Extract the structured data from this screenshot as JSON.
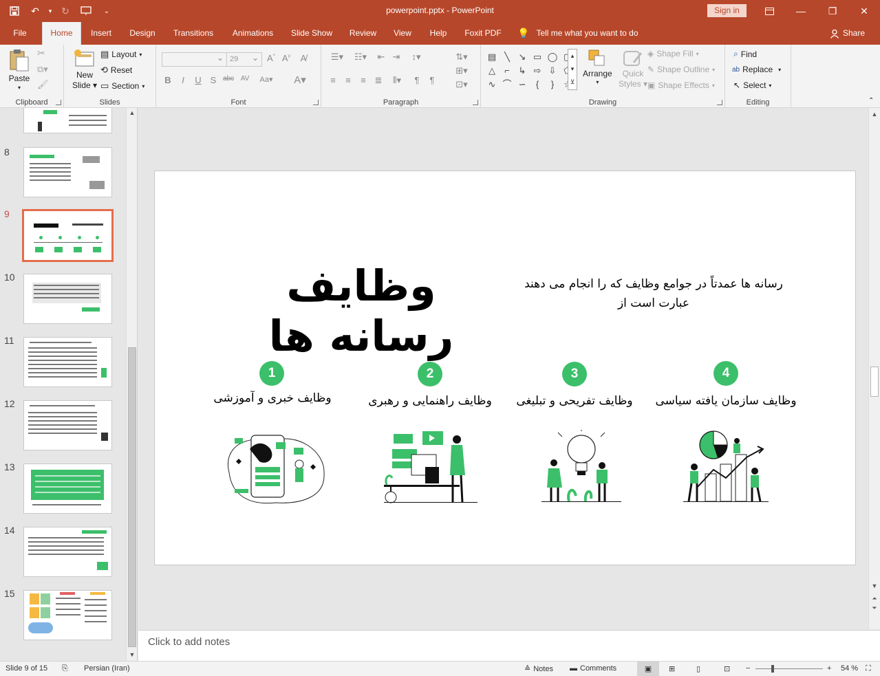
{
  "app": {
    "title": "powerpoint.pptx  -  PowerPoint",
    "sign_in": "Sign in",
    "accent": "#b7472a"
  },
  "tabs": [
    {
      "label": "File"
    },
    {
      "label": "Home",
      "active": true
    },
    {
      "label": "Insert"
    },
    {
      "label": "Design"
    },
    {
      "label": "Transitions"
    },
    {
      "label": "Animations"
    },
    {
      "label": "Slide Show"
    },
    {
      "label": "Review"
    },
    {
      "label": "View"
    },
    {
      "label": "Help"
    },
    {
      "label": "Foxit PDF"
    }
  ],
  "tell_me": "Tell me what you want to do",
  "share": "Share",
  "ribbon": {
    "clipboard": {
      "label": "Clipboard",
      "paste": "Paste"
    },
    "slides": {
      "label": "Slides",
      "new_slide": "New",
      "new_slide2": "Slide",
      "layout": "Layout",
      "reset": "Reset",
      "section": "Section"
    },
    "font": {
      "label": "Font",
      "font_size": "29"
    },
    "paragraph": {
      "label": "Paragraph"
    },
    "drawing": {
      "label": "Drawing",
      "arrange": "Arrange",
      "quick_styles": "Quick",
      "quick_styles2": "Styles",
      "shape_fill": "Shape Fill",
      "shape_outline": "Shape Outline",
      "shape_effects": "Shape Effects"
    },
    "editing": {
      "label": "Editing",
      "find": "Find",
      "replace": "Replace",
      "select": "Select"
    }
  },
  "thumbnails": [
    {
      "number": "8"
    },
    {
      "number": "9",
      "active": true
    },
    {
      "number": "10"
    },
    {
      "number": "11"
    },
    {
      "number": "12"
    },
    {
      "number": "13"
    },
    {
      "number": "14"
    },
    {
      "number": "15"
    }
  ],
  "slide": {
    "title": "وظایف رسانه ها",
    "subtitle_line1": "رسانه ها عمدتاً در جوامع وظایف که را انجام می دهند",
    "subtitle_line2": "عبارت است از",
    "functions": [
      {
        "number": "1",
        "label": "وظایف خبری و آموزشی"
      },
      {
        "number": "2",
        "label": "وظایف راهنمایی و رهبری"
      },
      {
        "number": "3",
        "label": "وظایف تفریحی و تبلیغی"
      },
      {
        "number": "4",
        "label": "وظایف سازمان یافته سیاسی"
      }
    ],
    "accent": "#3cbf6a"
  },
  "notes_placeholder": "Click to add notes",
  "status": {
    "slide_info": "Slide 9 of 15",
    "language": "Persian (Iran)",
    "notes": "Notes",
    "comments": "Comments",
    "zoom": "54 %"
  }
}
